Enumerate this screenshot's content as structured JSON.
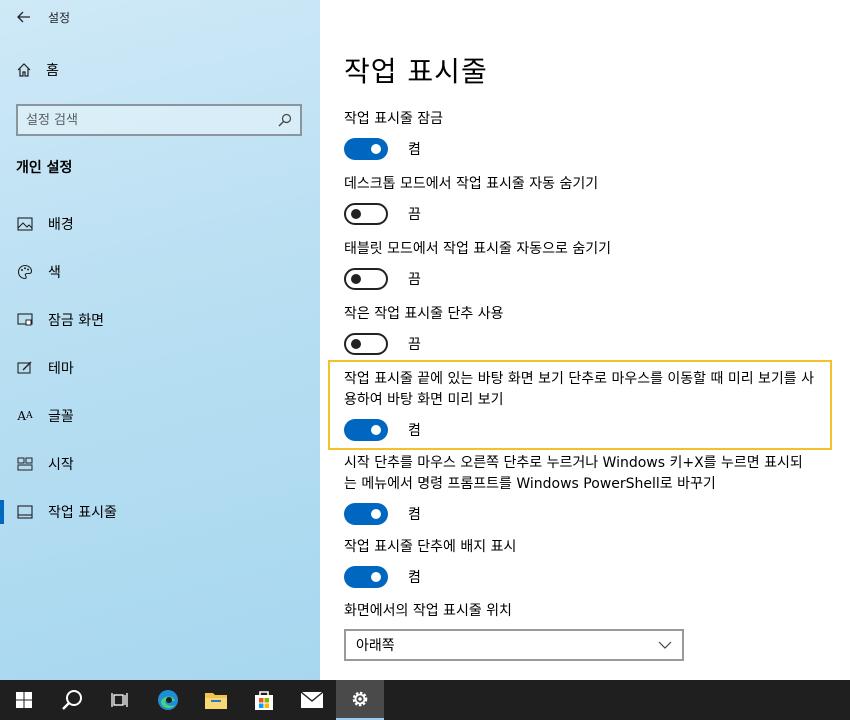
{
  "window": {
    "title": "설정"
  },
  "sidebar": {
    "home_label": "홈",
    "search_placeholder": "설정 검색",
    "section_title": "개인 설정",
    "items": [
      {
        "label": "배경",
        "icon": "picture-icon"
      },
      {
        "label": "색",
        "icon": "palette-icon"
      },
      {
        "label": "잠금 화면",
        "icon": "lock-screen-icon"
      },
      {
        "label": "테마",
        "icon": "theme-icon"
      },
      {
        "label": "글꼴",
        "icon": "font-icon"
      },
      {
        "label": "시작",
        "icon": "start-icon"
      },
      {
        "label": "작업 표시줄",
        "icon": "taskbar-icon",
        "active": true
      }
    ]
  },
  "main": {
    "title": "작업 표시줄",
    "settings": [
      {
        "label": "작업 표시줄 잠금",
        "state": "켬",
        "on": true
      },
      {
        "label": "데스크톱 모드에서 작업 표시줄 자동 숨기기",
        "state": "끔",
        "on": false
      },
      {
        "label": "태블릿 모드에서 작업 표시줄 자동으로 숨기기",
        "state": "끔",
        "on": false
      },
      {
        "label": "작은 작업 표시줄 단추 사용",
        "state": "끔",
        "on": false
      },
      {
        "label": "작업 표시줄 끝에 있는 바탕 화면 보기 단추로 마우스를 이동할 때 미리 보기를 사용하여 바탕 화면 미리 보기",
        "state": "켬",
        "on": true
      },
      {
        "label": "시작 단추를 마우스 오른쪽 단추로 누르거나 Windows 키+X를 누르면 표시되는 메뉴에서 명령 프롬프트를 Windows PowerShell로 바꾸기",
        "state": "켬",
        "on": true
      },
      {
        "label": "작업 표시줄 단추에 배지 표시",
        "state": "켬",
        "on": true
      }
    ],
    "location_label": "화면에서의 작업 표시줄 위치",
    "location_value": "아래쪽"
  },
  "taskbar": {
    "items": [
      "start-icon",
      "search-icon",
      "task-view-icon",
      "edge-icon",
      "file-explorer-icon",
      "store-icon",
      "mail-icon",
      "settings-icon"
    ]
  },
  "colors": {
    "accent": "#0067c0",
    "highlight": "#f5c02a",
    "taskbar": "#1f1f1f"
  }
}
